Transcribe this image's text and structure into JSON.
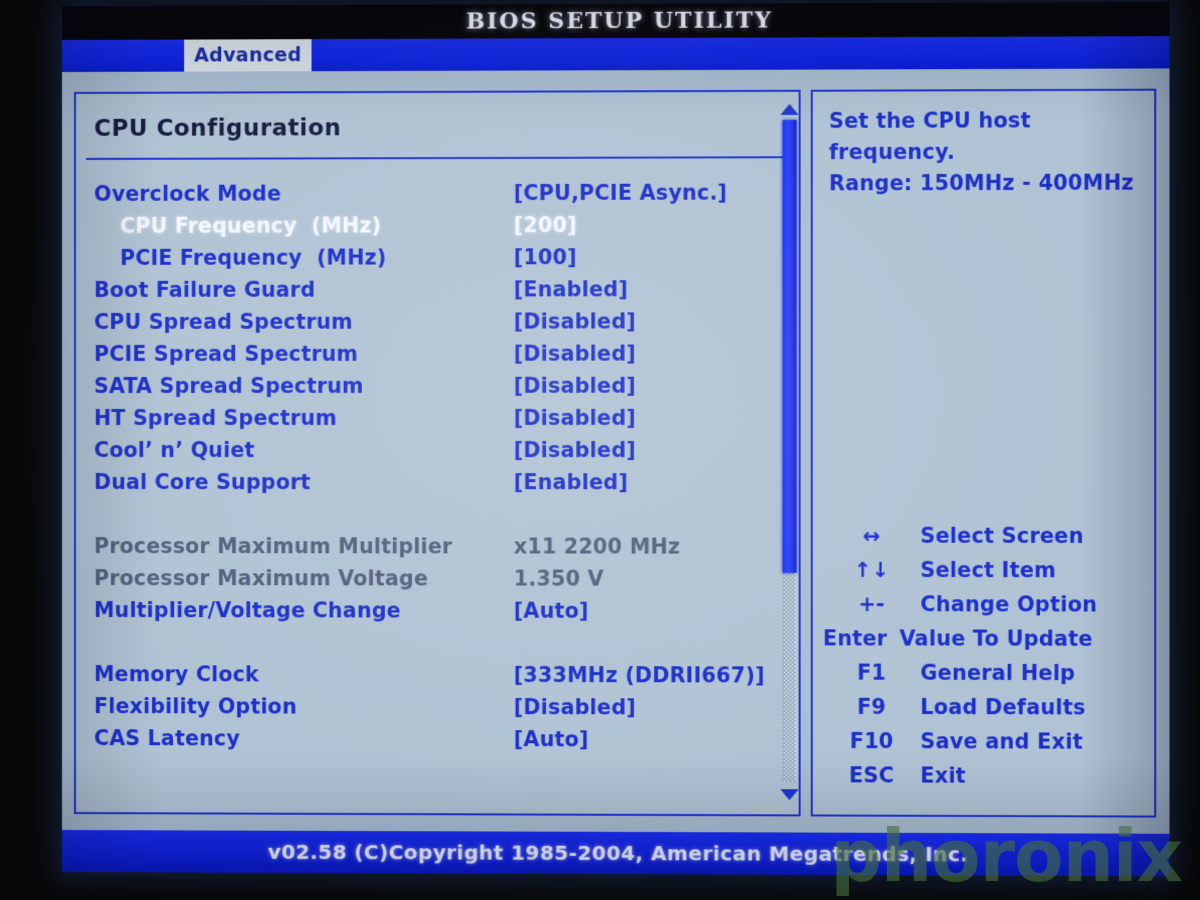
{
  "window": {
    "title": "BIOS SETUP UTILITY"
  },
  "menubar": {
    "tabs": [
      {
        "label": "Advanced",
        "active": true
      }
    ]
  },
  "main": {
    "section_title": "CPU Configuration",
    "rows": [
      {
        "label": "Overclock Mode",
        "value": "[CPU,PCIE Async.]",
        "style": "blue",
        "indent": 0,
        "selected": false
      },
      {
        "label": "CPU Frequency  (MHz)",
        "value": "[200]",
        "style": "white",
        "indent": 1,
        "selected": true
      },
      {
        "label": "PCIE Frequency  (MHz)",
        "value": "[100]",
        "style": "blue",
        "indent": 1,
        "selected": false
      },
      {
        "label": "Boot Failure Guard",
        "value": "[Enabled]",
        "style": "blue",
        "indent": 0,
        "selected": false
      },
      {
        "label": "CPU Spread Spectrum",
        "value": "[Disabled]",
        "style": "blue",
        "indent": 0,
        "selected": false
      },
      {
        "label": "PCIE Spread Spectrum",
        "value": "[Disabled]",
        "style": "blue",
        "indent": 0,
        "selected": false
      },
      {
        "label": "SATA Spread Spectrum",
        "value": "[Disabled]",
        "style": "blue",
        "indent": 0,
        "selected": false
      },
      {
        "label": "HT Spread Spectrum",
        "value": "[Disabled]",
        "style": "blue",
        "indent": 0,
        "selected": false
      },
      {
        "label": "Cool’ n’ Quiet",
        "value": "[Disabled]",
        "style": "blue",
        "indent": 0,
        "selected": false
      },
      {
        "label": "Dual Core Support",
        "value": "[Enabled]",
        "style": "blue",
        "indent": 0,
        "selected": false
      },
      {
        "label": "",
        "value": "",
        "style": "blue",
        "indent": 0,
        "selected": false
      },
      {
        "label": "Processor Maximum Multiplier",
        "value": "x11 2200 MHz",
        "style": "grey",
        "indent": 0,
        "selected": false
      },
      {
        "label": "Processor Maximum Voltage",
        "value": "1.350 V",
        "style": "grey",
        "indent": 0,
        "selected": false
      },
      {
        "label": "Multiplier/Voltage Change",
        "value": "[Auto]",
        "style": "blue",
        "indent": 0,
        "selected": false
      },
      {
        "label": "",
        "value": "",
        "style": "blue",
        "indent": 0,
        "selected": false
      },
      {
        "label": "Memory Clock",
        "value": "[333MHz (DDRII667)]",
        "style": "blue",
        "indent": 0,
        "selected": false
      },
      {
        "label": "Flexibility Option",
        "value": "[Disabled]",
        "style": "blue",
        "indent": 0,
        "selected": false
      },
      {
        "label": "CAS Latency",
        "value": "[Auto]",
        "style": "blue",
        "indent": 0,
        "selected": false
      }
    ]
  },
  "help": {
    "text": "Set the CPU host\nfrequency.\nRange: 150MHz - 400MHz"
  },
  "keylegend": [
    {
      "key": "↔",
      "desc": "Select Screen",
      "wide": false
    },
    {
      "key": "↑↓",
      "desc": "Select Item",
      "wide": false
    },
    {
      "key": "+-",
      "desc": "Change Option",
      "wide": false
    },
    {
      "key": "Enter",
      "desc": "Value To Update",
      "wide": true
    },
    {
      "key": "F1",
      "desc": "General Help",
      "wide": false
    },
    {
      "key": "F9",
      "desc": "Load Defaults",
      "wide": false
    },
    {
      "key": "F10",
      "desc": "Save and Exit",
      "wide": false
    },
    {
      "key": "ESC",
      "desc": "Exit",
      "wide": false
    }
  ],
  "footer": {
    "text": "v02.58 (C)Copyright 1985-2004, American Megatrends, Inc."
  },
  "watermark": {
    "text": "phoronix"
  },
  "scrollbar": {
    "up_icon": "triangle-up-icon",
    "down_icon": "triangle-down-icon"
  },
  "colors": {
    "screen_bg": "#a9bed1",
    "accent_blue": "#1b2ec9",
    "bar_blue": "#0f22e2",
    "selected_text": "#f4f7ff",
    "disabled_text": "#53607c",
    "watermark": "#46703a"
  }
}
